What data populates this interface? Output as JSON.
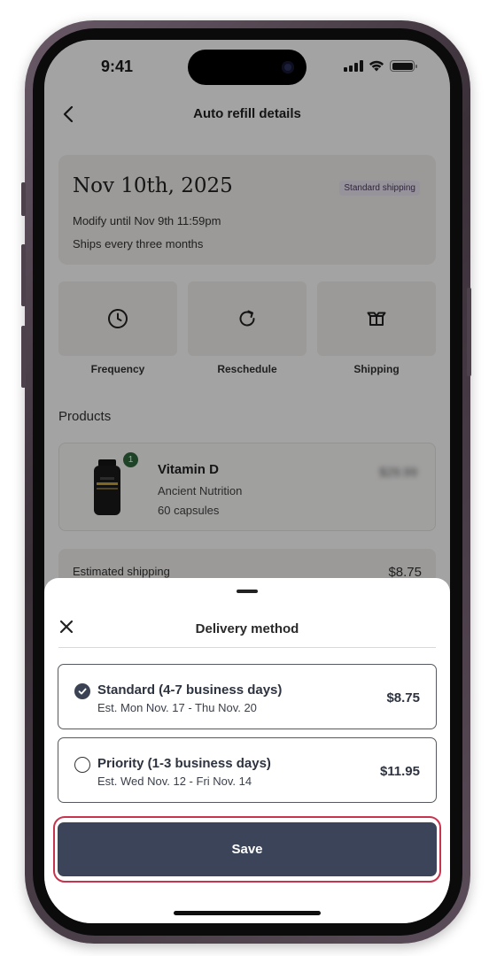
{
  "status_bar": {
    "time": "9:41"
  },
  "header": {
    "title": "Auto refill details",
    "back_icon": "chevron-left-icon"
  },
  "summary": {
    "date": "Nov 10th, 2025",
    "badge": "Standard shipping",
    "modify_text": "Modify until Nov 9th 11:59pm",
    "ships_text": "Ships every three months"
  },
  "actions": [
    {
      "label": "Frequency",
      "icon": "clock-icon"
    },
    {
      "label": "Reschedule",
      "icon": "refresh-icon"
    },
    {
      "label": "Shipping",
      "icon": "box-icon"
    }
  ],
  "products": {
    "heading": "Products",
    "items": [
      {
        "name": "Vitamin D",
        "brand": "Ancient Nutrition",
        "size": "60 capsules",
        "quantity": "1",
        "price": "$29.99"
      }
    ]
  },
  "estimated_shipping": {
    "label": "Estimated shipping",
    "value": "$8.75"
  },
  "sheet": {
    "title": "Delivery method",
    "options": [
      {
        "title": "Standard (4-7 business days)",
        "subtitle": "Est. Mon Nov. 17 - Thu Nov. 20",
        "price": "$8.75",
        "selected": true
      },
      {
        "title": "Priority (1-3 business days)",
        "subtitle": "Est. Wed Nov. 12 - Fri Nov. 14",
        "price": "$11.95",
        "selected": false
      }
    ],
    "save_label": "Save"
  },
  "colors": {
    "primary_button": "#3b4458",
    "highlight_ring": "#c8344e",
    "badge_bg": "#ece6f3",
    "quantity_badge": "#2f6a3e"
  }
}
